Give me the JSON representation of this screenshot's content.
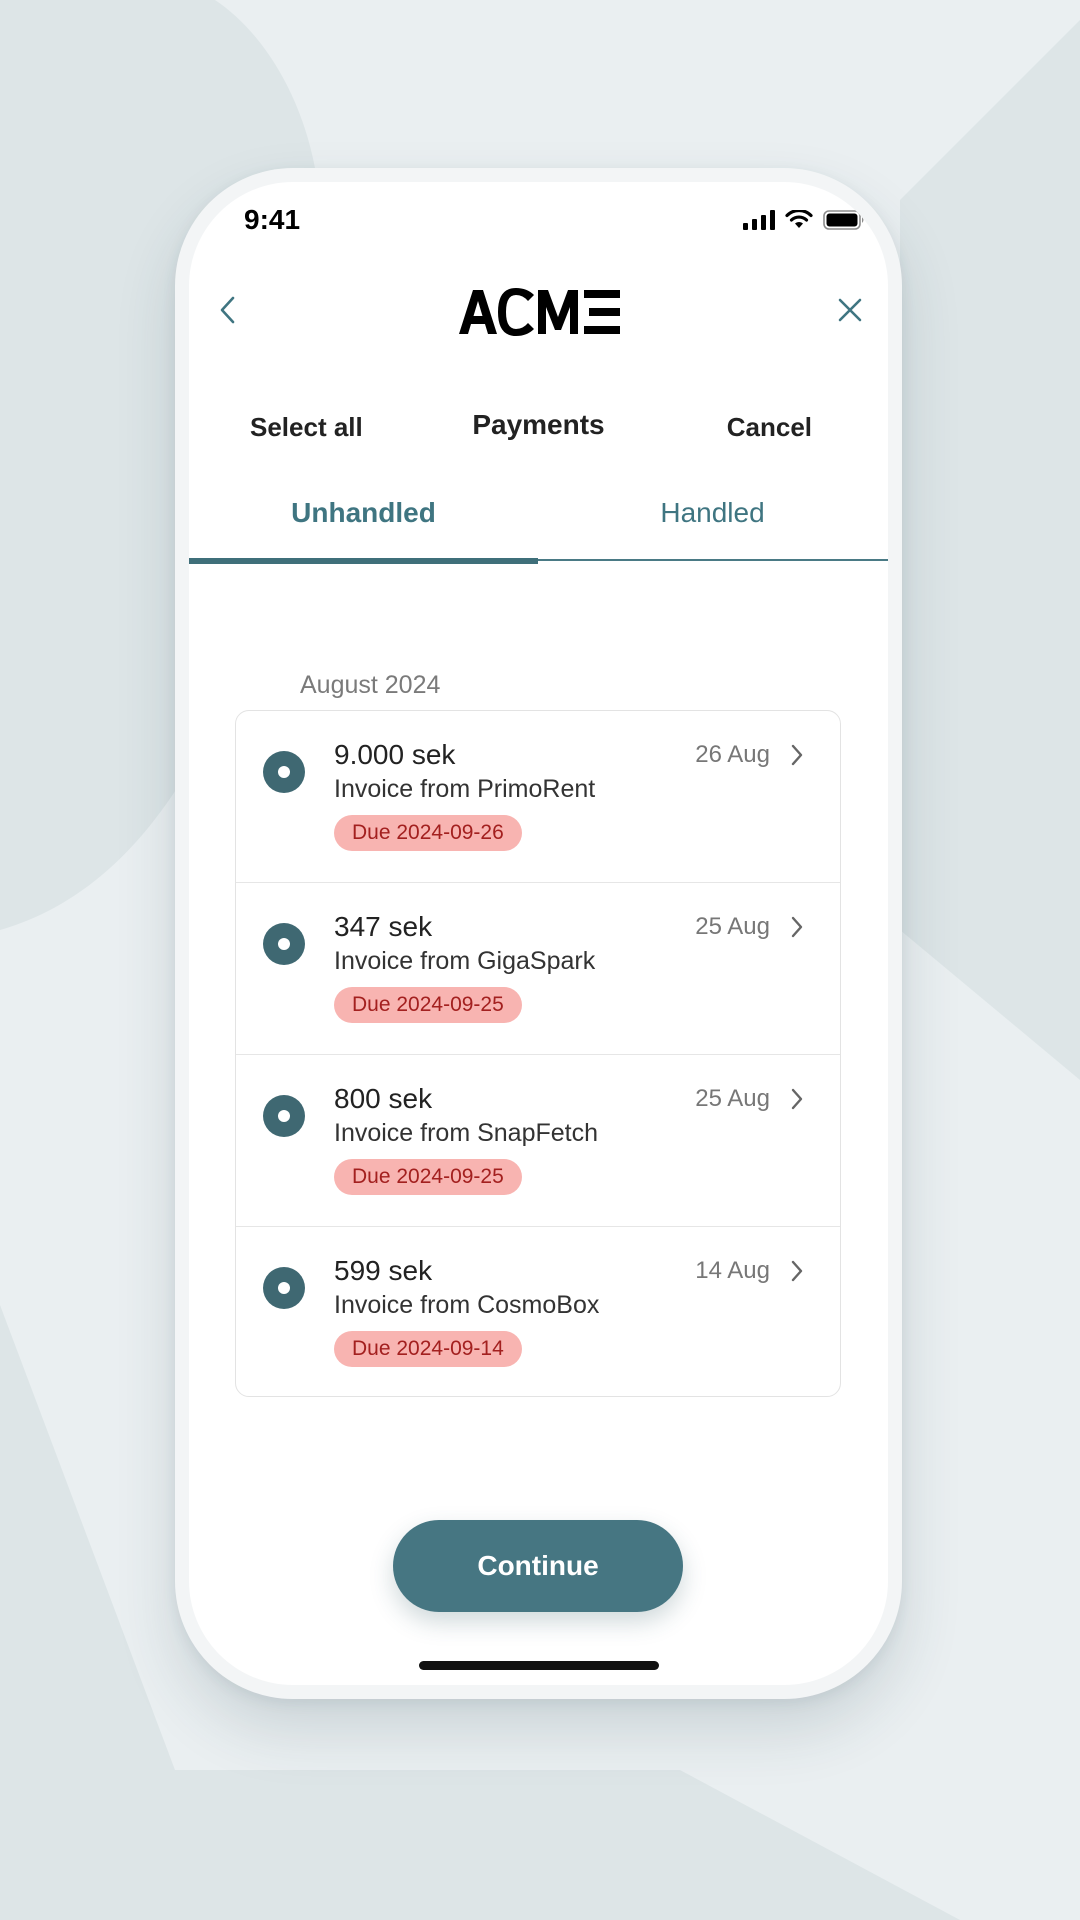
{
  "status_bar": {
    "time": "9:41"
  },
  "nav": {
    "logo_text": "ACME"
  },
  "header": {
    "select_all": "Select all",
    "title": "Payments",
    "cancel": "Cancel"
  },
  "tabs": [
    {
      "label": "Unhandled",
      "active": true
    },
    {
      "label": "Handled",
      "active": false
    }
  ],
  "section": {
    "label": "August 2024"
  },
  "payments": [
    {
      "amount": "9.000 sek",
      "description": "Invoice from PrimoRent",
      "due": "Due 2024-09-26",
      "date": "26 Aug"
    },
    {
      "amount": "347 sek",
      "description": "Invoice from GigaSpark",
      "due": "Due 2024-09-25",
      "date": "25 Aug"
    },
    {
      "amount": "800 sek",
      "description": "Invoice from SnapFetch",
      "due": "Due 2024-09-25",
      "date": "25 Aug"
    },
    {
      "amount": "599 sek",
      "description": "Invoice from CosmoBox",
      "due": "Due 2024-09-14",
      "date": "14 Aug"
    }
  ],
  "footer": {
    "continue_label": "Continue"
  },
  "colors": {
    "primary": "#467682",
    "tab_text": "#3f7581",
    "due_badge_bg": "#f8b4b1",
    "due_badge_text": "#a3201f",
    "background": "#dfe6e8"
  }
}
